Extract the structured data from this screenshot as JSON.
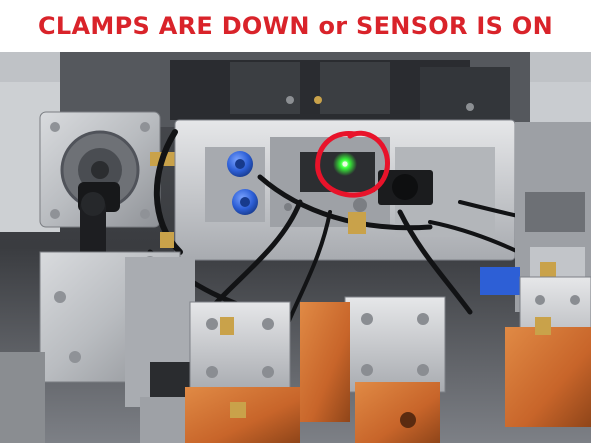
{
  "caption": {
    "text": "CLAMPS ARE DOWN or SENSOR IS ON",
    "color": "#d9232a"
  },
  "photo": {
    "subject": "machine-clamp-assembly",
    "annotation": {
      "shape": "hand-drawn-circle",
      "color": "#e8132a",
      "marks": "sensor-indicator"
    },
    "sensor_led_color": "#39ff3a",
    "palette": {
      "aluminum": "#b9bcc0",
      "dark_steel": "#2f3236",
      "copper_block": "#c8652a",
      "pneumatic_fitting_blue": "#2d5fd6",
      "brass": "#c9a24a"
    }
  }
}
